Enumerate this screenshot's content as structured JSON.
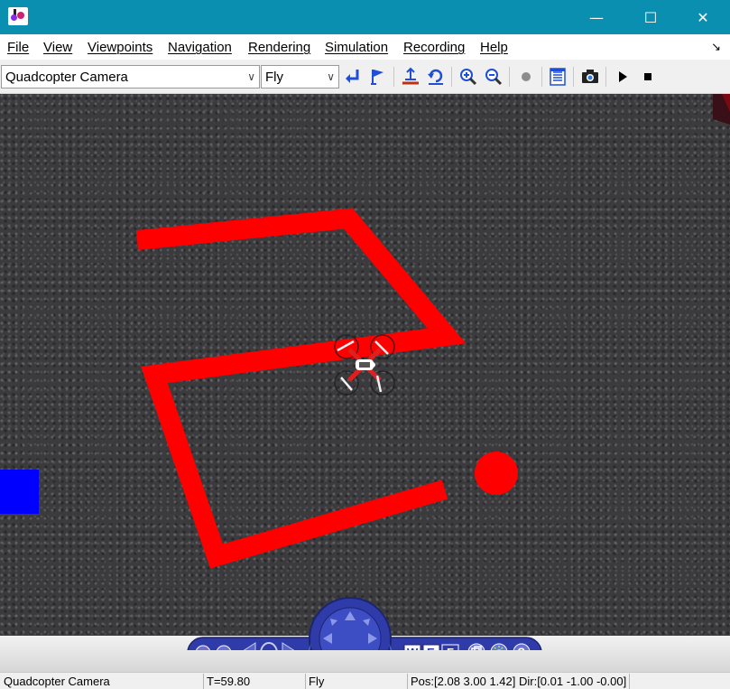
{
  "window": {
    "minimize_glyph": "—",
    "maximize_glyph": "☐",
    "close_glyph": "✕"
  },
  "menu": {
    "items": [
      {
        "label": "File"
      },
      {
        "label": "View"
      },
      {
        "label": "Viewpoints"
      },
      {
        "label": "Navigation"
      },
      {
        "label": "Rendering"
      },
      {
        "label": "Simulation"
      },
      {
        "label": "Recording"
      },
      {
        "label": "Help"
      }
    ]
  },
  "toolbar": {
    "viewpoint_value": "Quadcopter Camera",
    "navmode_value": "Fly",
    "icons": [
      "return-arrow-icon",
      "flag-icon",
      "level-view-icon",
      "undo-rotate-icon",
      "zoom-in-icon",
      "zoom-out-icon",
      "record-dot-icon",
      "console-icon",
      "snapshot-camera-icon",
      "play-icon",
      "stop-icon"
    ]
  },
  "viewport": {
    "colors": {
      "track": "#ff0000",
      "target": "#ff0000",
      "marker": "#0000ff",
      "ground": "#3b3b3e"
    },
    "objects": [
      "red-path-track",
      "quadcopter",
      "red-target-ball",
      "blue-marker-block"
    ]
  },
  "nav_controller": {
    "buttons": [
      "close-icon",
      "stop-icon",
      "rotate-left-icon",
      "dpad-icon",
      "rotate-right-icon",
      "walk-mode-icon",
      "examine-mode-icon",
      "fly-mode-icon",
      "fit-view-icon",
      "headlight-icon",
      "help-icon"
    ],
    "mode_letters": {
      "w": "W",
      "e": "E",
      "f": "F"
    },
    "help_glyph": "?",
    "accent": "#2b3aa0"
  },
  "status": {
    "viewpoint": "Quadcopter Camera",
    "time": "T=59.80",
    "mode": "Fly",
    "pose": "Pos:[2.08 3.00 1.42] Dir:[0.01 -1.00 -0.00]"
  }
}
